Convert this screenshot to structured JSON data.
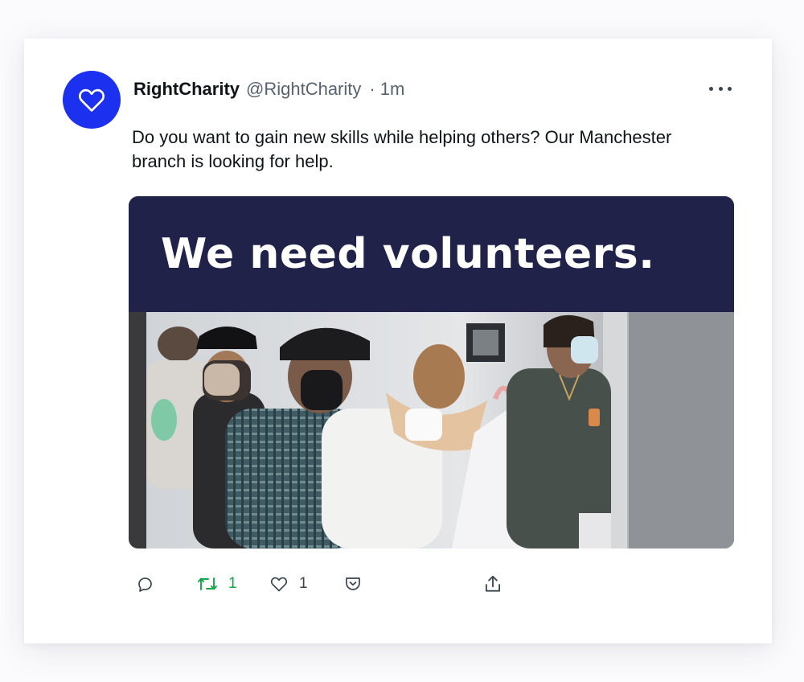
{
  "tweet": {
    "display_name": "RightCharity",
    "handle": "@RightCharity",
    "separator": "·",
    "time": "1m",
    "text": "Do you want to gain new skills while helping others? Our Manchester branch is looking for help.",
    "avatar": {
      "icon": "heart-outline-icon",
      "background": "#1c30f0"
    }
  },
  "media": {
    "headline": "We need volunteers.",
    "banner_color": "#20224a",
    "photo_description_icon": "volunteers-photo"
  },
  "actions": {
    "reply": {
      "icon": "reply-icon"
    },
    "retweet": {
      "icon": "retweet-icon",
      "count": "1",
      "color": "#17a34a"
    },
    "like": {
      "icon": "heart-icon",
      "count": "1"
    },
    "save": {
      "icon": "pocket-save-icon"
    },
    "share": {
      "icon": "share-icon"
    }
  },
  "menu": {
    "icon": "more-options-icon"
  }
}
